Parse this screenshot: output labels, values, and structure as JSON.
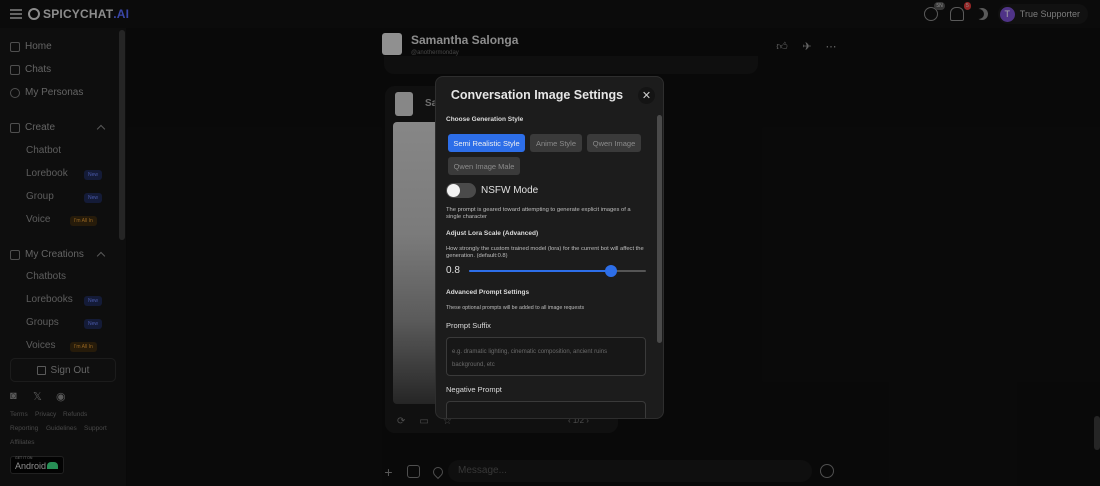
{
  "app": {
    "logo_text": "SPICYCHAT",
    "logo_ai": ".AI"
  },
  "topbar": {
    "coins_badge": "5N",
    "notif_badge": "5",
    "user_initial": "T",
    "user_label": "True Supporter"
  },
  "sidebar": {
    "home": "Home",
    "chats": "Chats",
    "personas": "My Personas",
    "create": "Create",
    "create_items": [
      {
        "label": "Chatbot",
        "tag": ""
      },
      {
        "label": "Lorebook",
        "tag": "New"
      },
      {
        "label": "Group",
        "tag": "New"
      },
      {
        "label": "Voice",
        "tag": "I'm All In"
      }
    ],
    "my_creations": "My Creations",
    "creations_items": [
      {
        "label": "Chatbots",
        "tag": ""
      },
      {
        "label": "Lorebooks",
        "tag": "New"
      },
      {
        "label": "Groups",
        "tag": "New"
      },
      {
        "label": "Voices",
        "tag": "I'm All In"
      }
    ],
    "sign_out": "Sign Out",
    "footer_links": [
      "Terms",
      "Privacy",
      "Refunds",
      "Reporting",
      "Guidelines",
      "Support",
      "Affiliates"
    ],
    "android_small": "GET IT ON",
    "android_label": "Android"
  },
  "chat": {
    "title": "Samantha Salonga",
    "handle": "@anothermonday",
    "bubble_name": "Sa",
    "pager": "1/2",
    "composer_placeholder": "Message..."
  },
  "modal": {
    "title": "Conversation Image Settings",
    "section_style": "Choose Generation Style",
    "styles": [
      {
        "label": "Semi Realistic Style",
        "active": true
      },
      {
        "label": "Anime Style",
        "active": false
      },
      {
        "label": "Qwen Image",
        "active": false
      },
      {
        "label": "Qwen Image Male",
        "active": false
      }
    ],
    "nsfw_label": "NSFW Mode",
    "nsfw_on": false,
    "nsfw_desc": "The prompt is geared toward attempting to generate explicit images of a single character",
    "lora_title": "Adjust Lora Scale (Advanced)",
    "lora_desc": "How strongly the custom trained model (lora) for the current bot will affect the generation. (default:0.8)",
    "lora_value": "0.8",
    "lora_fraction": 0.8,
    "advanced_title": "Advanced Prompt Settings",
    "advanced_desc": "These optional prompts will be added to all image requests",
    "suffix_label": "Prompt Suffix",
    "suffix_placeholder": "e.g. dramatic lighting, cinematic composition, ancient ruins background, etc",
    "negative_label": "Negative Prompt"
  },
  "colors": {
    "accent": "#2d6ee8",
    "tag_new": "#6f87ff",
    "tag_allin": "#e39a33"
  }
}
